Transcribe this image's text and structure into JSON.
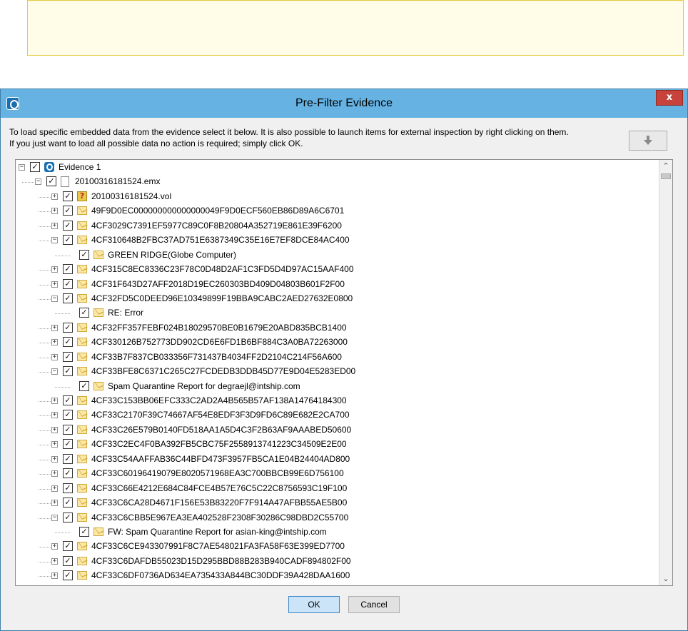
{
  "window": {
    "title": "Pre-Filter Evidence",
    "close_label": "x"
  },
  "description": {
    "line1": "To load specific embedded data from the evidence select it below. It is also possible to launch items for external inspection by right clicking on them.",
    "line2": "If you just want to load all possible data no action is required; simply click OK."
  },
  "tree": {
    "rows": [
      {
        "level": 0,
        "expander": "minus",
        "checked": true,
        "icon": "evidence",
        "label": "Evidence 1"
      },
      {
        "level": 1,
        "expander": "minus",
        "checked": true,
        "icon": "file",
        "label": "20100316181524.emx"
      },
      {
        "level": 2,
        "expander": "plus",
        "checked": true,
        "icon": "vol",
        "label": "20100316181524.vol"
      },
      {
        "level": 2,
        "expander": "plus",
        "checked": true,
        "icon": "mail",
        "label": "49F9D0EC000000000000000049F9D0ECF560EB86D89A6C6701"
      },
      {
        "level": 2,
        "expander": "plus",
        "checked": true,
        "icon": "mail",
        "label": "4CF3029C7391EF5977C89C0F8B20804A352719E861E39F6200"
      },
      {
        "level": 2,
        "expander": "minus",
        "checked": true,
        "icon": "mail",
        "label": "4CF310648B2FBC37AD751E6387349C35E16E7EF8DCE84AC400"
      },
      {
        "level": 3,
        "expander": "none",
        "checked": true,
        "icon": "mail",
        "label": "GREEN RIDGE(Globe Computer)"
      },
      {
        "level": 2,
        "expander": "plus",
        "checked": true,
        "icon": "mail",
        "label": "4CF315C8EC8336C23F78C0D48D2AF1C3FD5D4D97AC15AAF400"
      },
      {
        "level": 2,
        "expander": "plus",
        "checked": true,
        "icon": "mail",
        "label": "4CF31F643D27AFF2018D19EC260303BD409D04803B601F2F00"
      },
      {
        "level": 2,
        "expander": "minus",
        "checked": true,
        "icon": "mail",
        "label": "4CF32FD5C0DEED96E10349899F19BBA9CABC2AED27632E0800"
      },
      {
        "level": 3,
        "expander": "none",
        "checked": true,
        "icon": "mail",
        "label": "RE: Error"
      },
      {
        "level": 2,
        "expander": "plus",
        "checked": true,
        "icon": "mail",
        "label": "4CF32FF357FEBF024B18029570BE0B1679E20ABD835BCB1400"
      },
      {
        "level": 2,
        "expander": "plus",
        "checked": true,
        "icon": "mail",
        "label": "4CF330126B752773DD902CD6E6FD1B6BF884C3A0BA72263000"
      },
      {
        "level": 2,
        "expander": "plus",
        "checked": true,
        "icon": "mail",
        "label": "4CF33B7F837CB033356F731437B4034FF2D2104C214F56A600"
      },
      {
        "level": 2,
        "expander": "minus",
        "checked": true,
        "icon": "mail",
        "label": "4CF33BFE8C6371C265C27FCDEDB3DDB45D77E9D04E5283ED00"
      },
      {
        "level": 3,
        "expander": "none",
        "checked": true,
        "icon": "mail",
        "label": "Spam Quarantine Report for degraejl@intship.com"
      },
      {
        "level": 2,
        "expander": "plus",
        "checked": true,
        "icon": "mail",
        "label": "4CF33C153BB06EFC333C2AD2A4B565B57AF138A14764184300"
      },
      {
        "level": 2,
        "expander": "plus",
        "checked": true,
        "icon": "mail",
        "label": "4CF33C2170F39C74667AF54E8EDF3F3D9FD6C89E682E2CA700"
      },
      {
        "level": 2,
        "expander": "plus",
        "checked": true,
        "icon": "mail",
        "label": "4CF33C26E579B0140FD518AA1A5D4C3F2B63AF9AAABED50600"
      },
      {
        "level": 2,
        "expander": "plus",
        "checked": true,
        "icon": "mail",
        "label": "4CF33C2EC4F0BA392FB5CBC75F2558913741223C34509E2E00"
      },
      {
        "level": 2,
        "expander": "plus",
        "checked": true,
        "icon": "mail",
        "label": "4CF33C54AAFFAB36C44BFD473F3957FB5CA1E04B24404AD800"
      },
      {
        "level": 2,
        "expander": "plus",
        "checked": true,
        "icon": "mail",
        "label": "4CF33C60196419079E8020571968EA3C700BBCB99E6D756100"
      },
      {
        "level": 2,
        "expander": "plus",
        "checked": true,
        "icon": "mail",
        "label": "4CF33C66E4212E684C84FCE4B57E76C5C22C8756593C19F100"
      },
      {
        "level": 2,
        "expander": "plus",
        "checked": true,
        "icon": "mail",
        "label": "4CF33C6CA28D4671F156E53B83220F7F914A47AFBB55AE5B00"
      },
      {
        "level": 2,
        "expander": "minus",
        "checked": true,
        "icon": "mail",
        "label": "4CF33C6CBB5E967EA3EA402528F2308F30286C98DBD2C55700"
      },
      {
        "level": 3,
        "expander": "none",
        "checked": true,
        "icon": "mail",
        "label": "FW: Spam Quarantine Report for asian-king@intship.com"
      },
      {
        "level": 2,
        "expander": "plus",
        "checked": true,
        "icon": "mail",
        "label": "4CF33C6CE943307991F8C7AE548021FA3FA58F63E399ED7700"
      },
      {
        "level": 2,
        "expander": "plus",
        "checked": true,
        "icon": "mail",
        "label": "4CF33C6DAFDB55023D15D295BBD88B283B940CADF894802F00"
      },
      {
        "level": 2,
        "expander": "plus",
        "checked": true,
        "icon": "mail",
        "label": "4CF33C6DF0736AD634EA735433A844BC30DDF39A428DAA1600"
      }
    ]
  },
  "buttons": {
    "ok_label": "OK",
    "cancel_label": "Cancel"
  },
  "icons": {
    "app": "app-logo-icon",
    "down": "down-arrow-icon",
    "scroll_up": "scroll-up-icon",
    "scroll_down": "scroll-down-icon"
  },
  "colors": {
    "titlebar": "#66b3e3",
    "close": "#c7423a",
    "note_border": "#e6c93c",
    "note_fill": "#fffce8"
  }
}
